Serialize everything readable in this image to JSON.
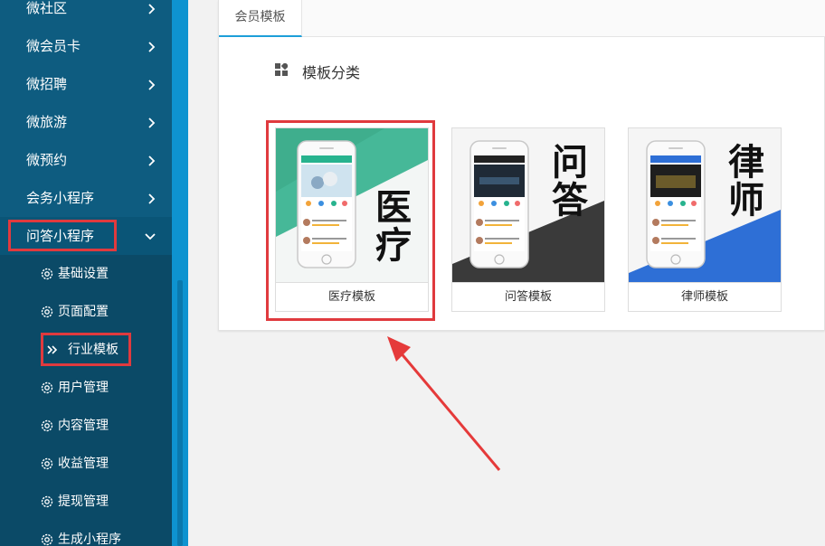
{
  "sidebar": {
    "items": [
      {
        "label": "微社区"
      },
      {
        "label": "微会员卡"
      },
      {
        "label": "微招聘"
      },
      {
        "label": "微旅游"
      },
      {
        "label": "微预约"
      },
      {
        "label": "会务小程序"
      },
      {
        "label": "问答小程序"
      }
    ],
    "sub_items": [
      {
        "label": "基础设置"
      },
      {
        "label": "页面配置"
      },
      {
        "label": "行业模板"
      },
      {
        "label": "用户管理"
      },
      {
        "label": "内容管理"
      },
      {
        "label": "收益管理"
      },
      {
        "label": "提现管理"
      },
      {
        "label": "生成小程序"
      }
    ],
    "icons": {
      "chevron": "chevron-right-icon",
      "chevron_open": "chevron-down-icon",
      "gear": "gear-icon",
      "double_arrow": "double-chevron-right-icon"
    }
  },
  "main": {
    "tab_label": "会员模板",
    "section_title": "模板分类",
    "section_icon": "grid-icon",
    "cards": [
      {
        "label": "医疗模板",
        "big_text": [
          "医",
          "疗"
        ],
        "accent": "#27b38e"
      },
      {
        "label": "问答模板",
        "big_text": [
          "问",
          "答"
        ],
        "accent": "#333333"
      },
      {
        "label": "律师模板",
        "big_text": [
          "律",
          "师"
        ],
        "accent": "#2e6fd6"
      }
    ]
  },
  "colors": {
    "sidebar_bg": "#0e5c80",
    "submenu_bg": "#0b4a67",
    "highlight_red": "#e03a3e",
    "tab_accent": "#1e9fd8"
  }
}
